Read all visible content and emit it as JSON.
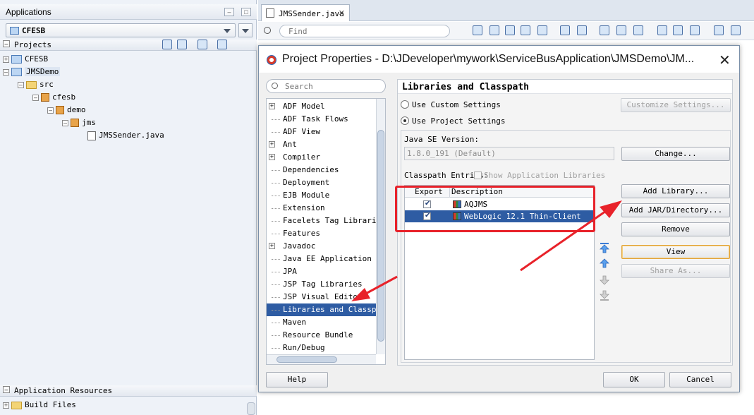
{
  "left_panel": {
    "applications_title": "Applications",
    "app_selector": "CFESB",
    "projects_title": "Projects",
    "tree": [
      {
        "label": "CFESB",
        "type": "project"
      },
      {
        "label": "JMSDemo",
        "type": "project"
      },
      {
        "label": "src",
        "type": "folder"
      },
      {
        "label": "cfesb",
        "type": "package"
      },
      {
        "label": "demo",
        "type": "package"
      },
      {
        "label": "jms",
        "type": "package"
      },
      {
        "label": "JMSSender.java",
        "type": "file"
      }
    ],
    "app_resources_title": "Application Resources",
    "build_files": "Build Files"
  },
  "editor": {
    "tab_label": "JMSSender.java",
    "find_placeholder": "Find"
  },
  "dialog": {
    "title": "Project Properties - D:\\JDeveloper\\mywork\\ServiceBusApplication\\JMSDemo\\JM...",
    "search_placeholder": "Search",
    "nav_items": [
      {
        "label": "ADF Model",
        "expandable": true
      },
      {
        "label": "ADF Task Flows",
        "expandable": false
      },
      {
        "label": "ADF View",
        "expandable": false
      },
      {
        "label": "Ant",
        "expandable": true
      },
      {
        "label": "Compiler",
        "expandable": true
      },
      {
        "label": "Dependencies",
        "expandable": false
      },
      {
        "label": "Deployment",
        "expandable": false
      },
      {
        "label": "EJB Module",
        "expandable": false
      },
      {
        "label": "Extension",
        "expandable": false
      },
      {
        "label": "Facelets Tag Libraries",
        "expandable": false
      },
      {
        "label": "Features",
        "expandable": false
      },
      {
        "label": "Javadoc",
        "expandable": true
      },
      {
        "label": "Java EE Application",
        "expandable": false
      },
      {
        "label": "JPA",
        "expandable": false
      },
      {
        "label": "JSP Tag Libraries",
        "expandable": false
      },
      {
        "label": "JSP Visual Editor",
        "expandable": false
      },
      {
        "label": "Libraries and Classpath",
        "expandable": false,
        "selected": true
      },
      {
        "label": "Maven",
        "expandable": false
      },
      {
        "label": "Resource Bundle",
        "expandable": false
      },
      {
        "label": "Run/Debug",
        "expandable": false
      }
    ],
    "section_title": "Libraries and Classpath",
    "use_custom_settings": "Use Custom Settings",
    "customize_settings_button": "Customize Settings...",
    "use_project_settings": "Use Project Settings",
    "java_se_version_label": "Java SE Version:",
    "java_se_version_value": "1.8.0_191 (Default)",
    "change_button": "Change...",
    "classpath_entries_label": "Classpath Entries:",
    "show_app_libraries": "Show Application Libraries",
    "table_headers": {
      "export": "Export",
      "description": "Description"
    },
    "classpath_rows": [
      {
        "exported": true,
        "description": "AQJMS",
        "selected": false
      },
      {
        "exported": true,
        "description": "WebLogic 12.1 Thin-Client",
        "selected": true
      }
    ],
    "buttons": {
      "add_library": "Add Library...",
      "add_jar": "Add JAR/Directory...",
      "remove": "Remove",
      "view": "View",
      "share_as": "Share As...",
      "help": "Help",
      "ok": "OK",
      "cancel": "Cancel"
    }
  },
  "annotations": {
    "highlight_color": "#e8222a"
  }
}
